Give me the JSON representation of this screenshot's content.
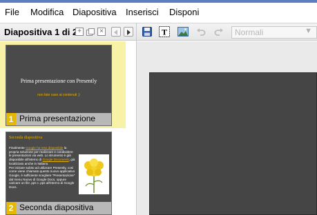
{
  "menu": [
    "File",
    "Modifica",
    "Diapositiva",
    "Inserisci",
    "Disponi"
  ],
  "toolbar": {
    "slide_counter": "Diapositiva 1 di 2",
    "style_select": {
      "value": "Normali"
    }
  },
  "icons": {
    "add_slide": "plus-box-icon",
    "duplicate_slide": "duplicate-icon",
    "delete_slide": "x-box-icon",
    "prev": "arrow-left-icon",
    "next": "arrow-right-icon",
    "save": "floppy-disk-icon",
    "text": "text-box-icon",
    "image": "image-icon",
    "undo": "undo-icon",
    "redo": "redo-icon"
  },
  "slides": [
    {
      "number": "1",
      "label": "Prima presentazione",
      "title": "Prima presentazione con Presently",
      "subtitle": "non fate caso ai contenuti ;)"
    },
    {
      "number": "2",
      "label": "Seconda diapositiva",
      "title": "Seconda diapositiva",
      "body": {
        "p1_a": "Finalmente ",
        "p1_link": "Google ha reso disponibile",
        "p1_b": " la propria soluzione per realizzare e condividere le presentazioni via web. Lo strumento è già disponibile all'interno di ",
        "p1_link2": "Google Documenti",
        "p1_c": ", già localizzato anche in Italiano.",
        "p2": "Per iniziare subito ad utilizzare Presently, così come viene chiamato questo nuovo applicativo Google, è sufficiente scegliere \"Presentazione\" dal menu Nuovo di Google Docs, oppure caricare un file .ppt o .pps all'interno di Google Docs."
      }
    }
  ],
  "colors": {
    "accent_bar": "#5b7fbf",
    "selected_thumb_bg": "#f8f2a6",
    "slide_number_badge": "#e6b800",
    "slide_bg": "#454545"
  }
}
